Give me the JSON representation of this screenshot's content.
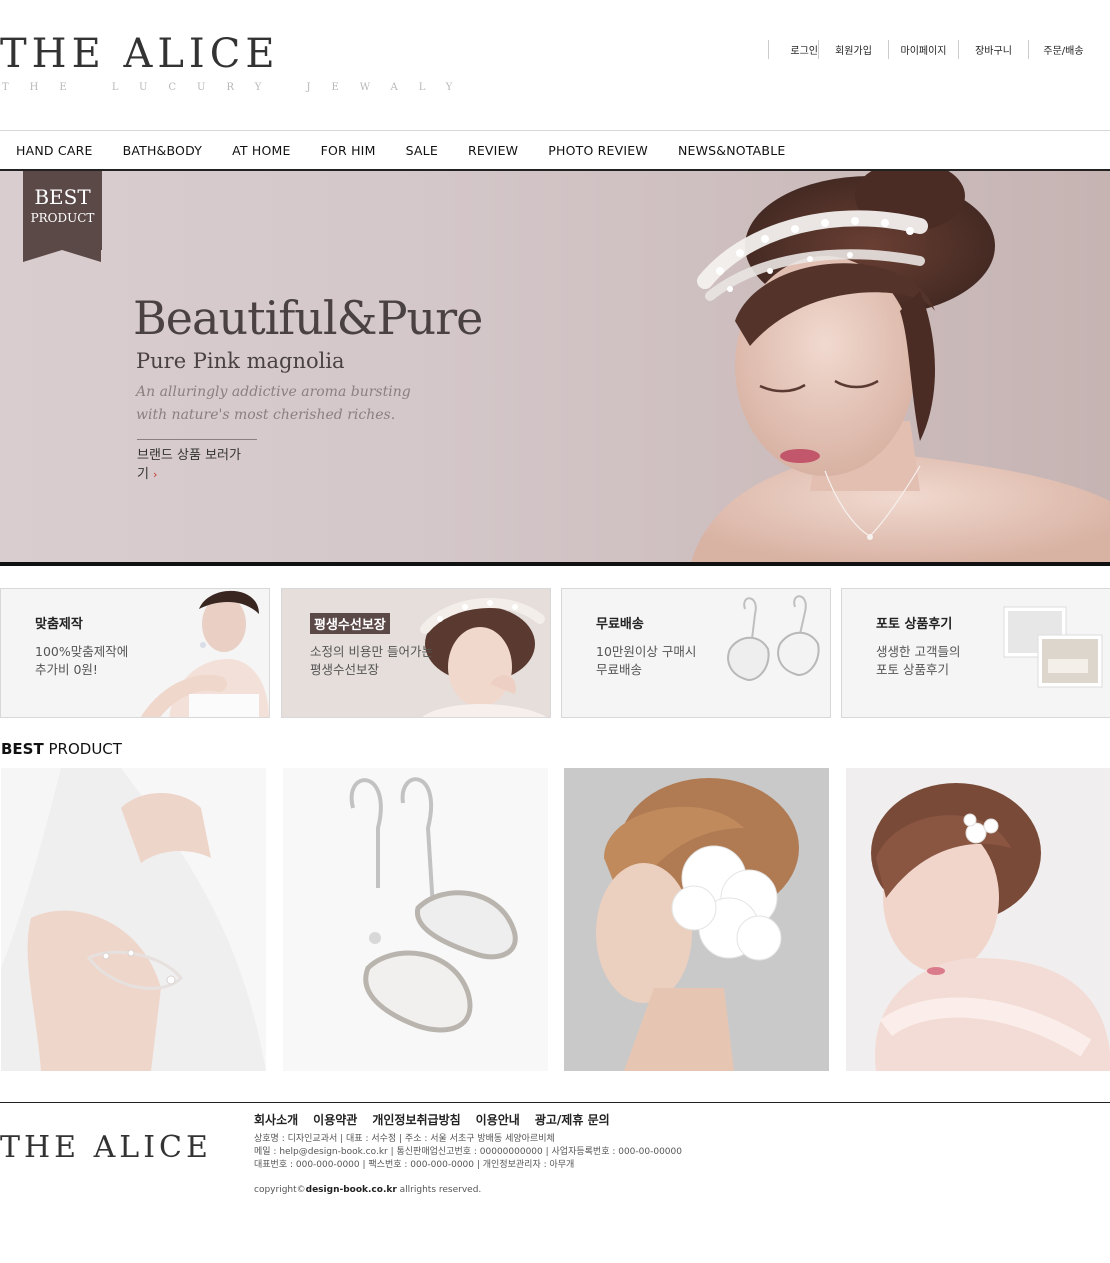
{
  "header": {
    "logo": "THE ALICE",
    "tagline": "THE LUCURY JEWALY",
    "topnav": [
      "로그인",
      "회원가입",
      "마이페이지",
      "장바구니",
      "주문/배송"
    ]
  },
  "mainnav": [
    "HAND CARE",
    "BATH&BODY",
    "AT HOME",
    "FOR HIM",
    "SALE",
    "REVIEW",
    "PHOTO REVIEW",
    "NEWS&NOTABLE"
  ],
  "hero": {
    "badge_line1": "BEST",
    "badge_line2": "PRODUCT",
    "title": "Beautiful&Pure",
    "subtitle": "Pure Pink magnolia",
    "description": "An alluringly addictive aroma bursting with nature's most cherished riches.",
    "link_label": "브랜드 상품 보러가기",
    "link_arrow": "›"
  },
  "features": [
    {
      "title": "맞춤제작",
      "line1": "100%맞춤제작에",
      "line2": "추가비 0원!"
    },
    {
      "title": "평생수선보장",
      "line1": "소정의 비용만 들어가는",
      "line2": "평생수선보장"
    },
    {
      "title": "무료배송",
      "line1": "10만원이상 구매시",
      "line2": "무료배송"
    },
    {
      "title": "포토 상품후기",
      "line1": "생생한 고객들의",
      "line2": "포토 상품후기"
    }
  ],
  "best": {
    "title_bold": "BEST",
    "title_rest": "PRODUCT"
  },
  "footer": {
    "logo": "THE ALICE",
    "links": [
      "회사소개",
      "이용약관",
      "개인정보취급방침",
      "이용안내",
      "광고/제휴 문의"
    ],
    "info1": "상호명 : 디자인교과서 | 대표 : 서수정 | 주소 : 서울 서초구 방배동 세양아르비체",
    "info2": "메일 : help@design-book.co.kr | 통신판매업신고번호 : 00000000000 | 사업자등록번호 : 000-00-00000",
    "info3": "대표번호 : 000-000-0000 | 팩스번호 : 000-000-0000 | 개인정보관리자 : 아무개",
    "copy_pre": "copyright©",
    "copy_site": "design-book.co.kr",
    "copy_post": " allrights reserved."
  },
  "colors": {
    "badge": "#5b4948",
    "hero_bg": "#d4c7c9",
    "accent_arrow": "#c0392b"
  }
}
